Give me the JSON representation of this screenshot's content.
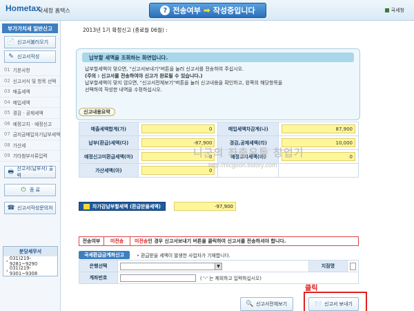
{
  "topbar": {
    "logo": "Hometax",
    "logo_sub": "국세청 홈택스",
    "banner_q": "?",
    "banner_left": "전송여부",
    "banner_arrow": "➡",
    "banner_right": "작성중입니다",
    "nts": "국세청"
  },
  "sidebar": {
    "title": "부가가치세 일반신고",
    "load_btn": "신고서불러오기",
    "write_btn": "신고서작성",
    "items": [
      {
        "n": "01",
        "label": "기본사항"
      },
      {
        "n": "02",
        "label": "신고서식 및 항목 선택"
      },
      {
        "n": "03",
        "label": "매출세액"
      },
      {
        "n": "04",
        "label": "매입세액"
      },
      {
        "n": "05",
        "label": "경감 · 공제세액"
      },
      {
        "n": "06",
        "label": "예정고지 · 예정신고"
      },
      {
        "n": "07",
        "label": "금지금매입자기납부세액"
      },
      {
        "n": "08",
        "label": "가산세"
      },
      {
        "n": "09",
        "label": "기타첨부서류입력"
      }
    ],
    "print_btn": "신고서(납부서) 출력",
    "exit_btn": "종 료",
    "contact_btn": "신고서작성문의처",
    "office": {
      "title": "분당세무서",
      "phones": [
        "031)219-9281~9290",
        "031)219-9301~9308"
      ]
    }
  },
  "main": {
    "period": "2013년 1기 확정신고 (종료월 06월) : ",
    "notice": {
      "head": "납부할 세액을 조회하는 화면입니다.",
      "lines": [
        "납부할세액이 맞으면, \"신고서보내기\"버튼을 눌러 신고서를 전송하여 주십시오.",
        "(주의 : 신고서를 전송하여야 신고가 완료될 수 있습니다.)",
        "납부할세액이 맞지 않으면, \"신고서전체보기\"버튼을 눌러 신고내용을 확인하고, 왼쪽의 해당항목을",
        "선택하여 작성한 내역을 수정하십시오."
      ]
    },
    "summary_btn": "신고내용요약",
    "summary": {
      "sales_tax_label": "매출세액합계(가)",
      "sales_tax_value": "0",
      "purchase_tax_label": "매입세액차감계(나)",
      "purchase_tax_value": "87,900",
      "payable_label": "납부(환급)세액(다)",
      "payable_value": "-87,900",
      "deduction_label": "경감,공제세액(라)",
      "deduction_value": "10,000",
      "prelim_label": "예정신고미환급세액(마)",
      "prelim_value": "0",
      "notice_tax_label": "예정고지세액(바)",
      "notice_tax_value": "0",
      "penalty_label": "가산세액(아)",
      "penalty_value": "0"
    },
    "watermark": "니군의 좌충우돌 창업기",
    "watermark_url": "http://nicgoon.tistory.com",
    "final_label": "차가감납부할세액 (환급받을세액)",
    "final_value": "-97,900",
    "status": {
      "key": "전송여부",
      "value": "미전송",
      "msg_red": "미전송",
      "msg_rest": "인 경우 신고서보내기 버튼을 클릭하여 신고서를 전송하셔야 합니다."
    },
    "refund": {
      "tab": "국세환급금계좌신고",
      "note": "환급받을 세액이 발생한 사업자가 기재합니다.",
      "bank_label": "은행선택",
      "branch_label": "지점명",
      "account_label": "계좌번호",
      "account_note": "( '-' 는 제외하고 입력하십시오)",
      "dropdown_icon": "▼"
    },
    "view_btn": "신고서전체보기",
    "send_btn": "신고서 보내기",
    "click_label": "클릭"
  }
}
